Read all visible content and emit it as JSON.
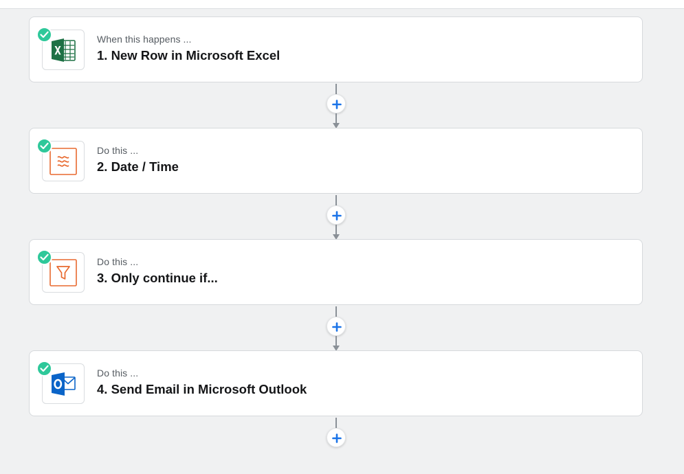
{
  "steps": [
    {
      "subtitle": "When this happens ...",
      "title": "1. New Row in Microsoft Excel",
      "app_icon": "excel-icon",
      "status": "check-icon"
    },
    {
      "subtitle": "Do this ...",
      "title": "2. Date / Time",
      "app_icon": "formatter-icon",
      "status": "check-icon"
    },
    {
      "subtitle": "Do this ...",
      "title": "3. Only continue if...",
      "app_icon": "filter-icon",
      "status": "check-icon"
    },
    {
      "subtitle": "Do this ...",
      "title": "4. Send Email in Microsoft Outlook",
      "app_icon": "outlook-icon",
      "status": "check-icon"
    }
  ],
  "add_step": {
    "icon": "plus-icon"
  },
  "colors": {
    "check_green": "#2ec89a",
    "add_blue": "#1a73e8",
    "excel_green": "#1e7145",
    "zapier_orange": "#e8692e",
    "outlook_blue": "#0a64c8",
    "connector_gray": "#8a9097",
    "background": "#f0f1f2"
  }
}
